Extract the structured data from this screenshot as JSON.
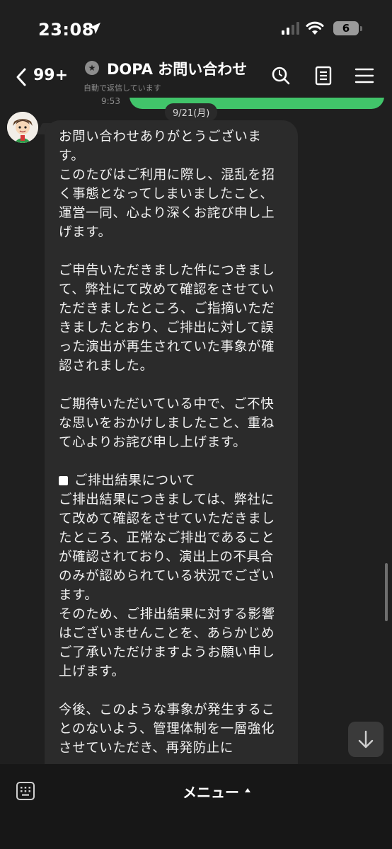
{
  "status_bar": {
    "time": "23:08",
    "battery": "6"
  },
  "header": {
    "unread_count": "99+",
    "chat_title": "DOPA お問い合わせ",
    "subtitle": "自動で返信しています",
    "icons": [
      "chevron-left-icon",
      "search-icon",
      "notes-icon",
      "menu-icon"
    ]
  },
  "chat": {
    "previous_time": "9:53",
    "date_label": "9/21(月)",
    "message": {
      "p1": "お問い合わせありがとうございます。\nこのたびはご利用に際し、混乱を招く事態となってしまいましたこと、運営一同、心より深くお詫び申し上げます。",
      "p2": "ご申告いただきました件につきまして、弊社にて改めて確認をさせていただきましたところ、ご指摘いただきましたとおり、ご排出に対して誤った演出が再生されていた事象が確認されました。",
      "p3": "ご期待いただいている中で、ご不快な思いをおかけしましたこと、重ねて心よりお詫び申し上げます。",
      "p4_heading": "ご排出結果について",
      "p4_body": "ご排出結果につきましては、弊社にて改めて確認をさせていただきましたところ、正常なご排出であることが確認されており、演出上の不具合のみが認められている状況でございます。\nそのため、ご排出結果に対する影響はございませんことを、あらかじめご了承いただけますようお願い申し上げます。",
      "p5": "今後、このような事象が発生することのないよう、管理体制を一層強化させていただき、再発防止に"
    }
  },
  "bottom_bar": {
    "menu_label": "メニュー"
  },
  "colors": {
    "background": "#1f1f1f",
    "bubble_in": "#2b2b2b",
    "bubble_out": "#41c46a",
    "bottom_bar": "#171717"
  }
}
